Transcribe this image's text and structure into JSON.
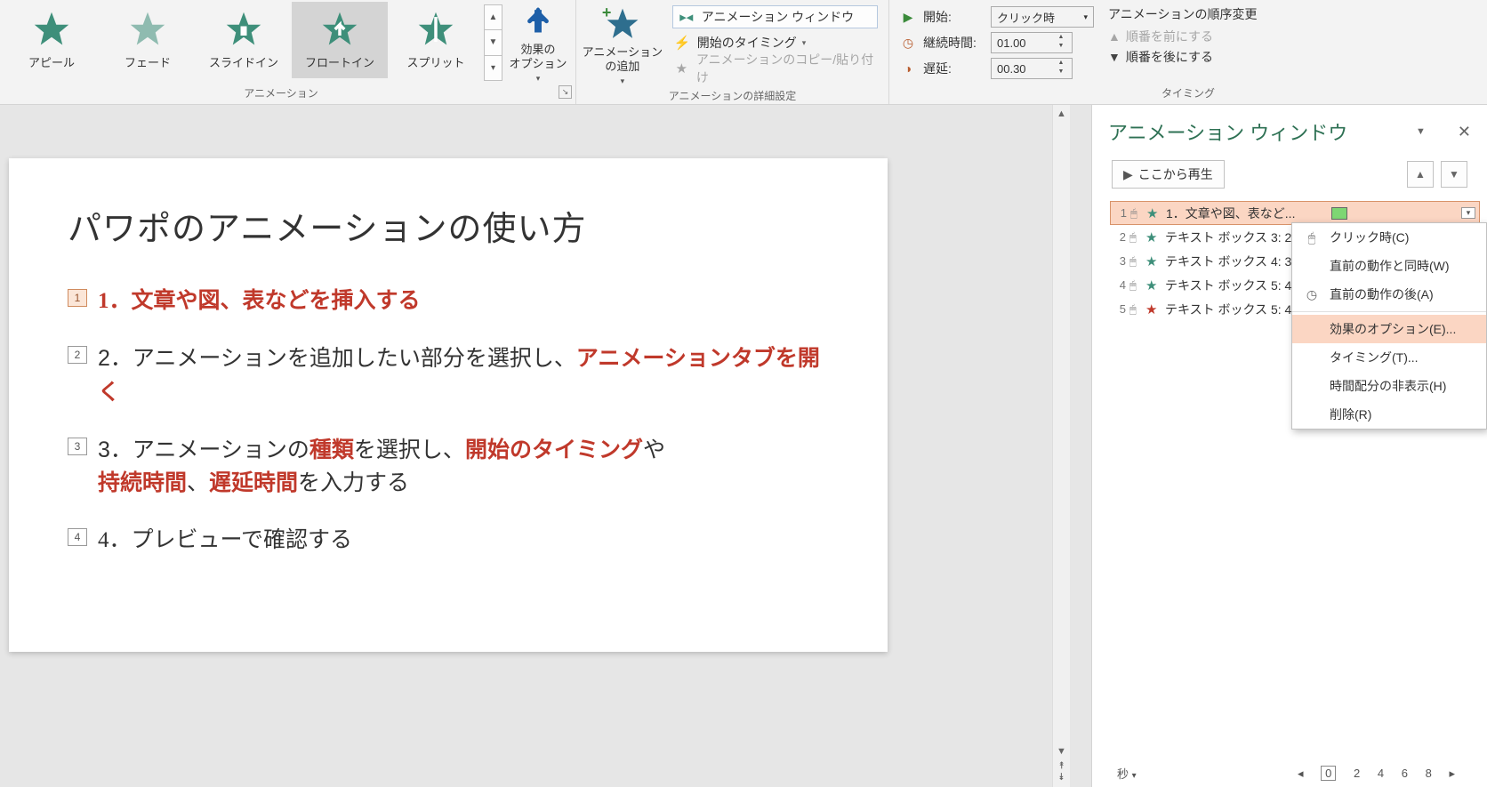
{
  "ribbon": {
    "gallery": [
      {
        "label": "アピール"
      },
      {
        "label": "フェード"
      },
      {
        "label": "スライドイン"
      },
      {
        "label": "フロートイン",
        "selected": true
      },
      {
        "label": "スプリット"
      }
    ],
    "effect_options": "効果の\nオプション",
    "add_animation": "アニメーション\nの追加",
    "detail": {
      "pane": "アニメーション ウィンドウ",
      "trigger": "開始のタイミング",
      "copy": "アニメーションのコピー/貼り付け"
    },
    "timing": {
      "start_label": "開始:",
      "start_value": "クリック時",
      "duration_label": "継続時間:",
      "duration_value": "01.00",
      "delay_label": "遅延:",
      "delay_value": "00.30"
    },
    "reorder": {
      "title": "アニメーションの順序変更",
      "earlier": "順番を前にする",
      "later": "順番を後にする"
    },
    "group_anim": "アニメーション",
    "group_detail": "アニメーションの詳細設定",
    "group_timing": "タイミング"
  },
  "slide": {
    "title": "パワポのアニメーションの使い方",
    "tags": [
      "1",
      "2",
      "3",
      "4"
    ],
    "line1": "1．文章や図、表などを挿入する",
    "line2a": "2．アニメーションを追加したい部分を選択し、",
    "line2b": "アニメーションタブを開く",
    "line3_pre": "3．アニメーションの",
    "line3_k1": "種類",
    "line3_mid": "を選択し、",
    "line3_k2": "開始のタイミング",
    "line3_ya": "や",
    "line3_k3": "持続時間",
    "line3_c": "、",
    "line3_k4": "遅延時間",
    "line3_post": "を入力する",
    "line4": "4．プレビューで確認する"
  },
  "pane": {
    "title": "アニメーション ウィンドウ",
    "play": "ここから再生",
    "items": [
      {
        "n": "1",
        "name": "1．文章や図、表など...",
        "sel": true,
        "star": "green"
      },
      {
        "n": "2",
        "name": "テキスト ボックス 3: 2",
        "star": "green"
      },
      {
        "n": "3",
        "name": "テキスト ボックス 4: 3",
        "star": "green"
      },
      {
        "n": "4",
        "name": "テキスト ボックス 5: 4",
        "star": "green"
      },
      {
        "n": "5",
        "name": "テキスト ボックス 5: 4",
        "star": "red"
      }
    ],
    "menu": {
      "click": "クリック時(C)",
      "with": "直前の動作と同時(W)",
      "after": "直前の動作の後(A)",
      "effect": "効果のオプション(E)...",
      "timing": "タイミング(T)...",
      "hide": "時間配分の非表示(H)",
      "remove": "削除(R)"
    },
    "seconds": "秒",
    "ticks": [
      "0",
      "2",
      "4",
      "6",
      "8"
    ]
  }
}
